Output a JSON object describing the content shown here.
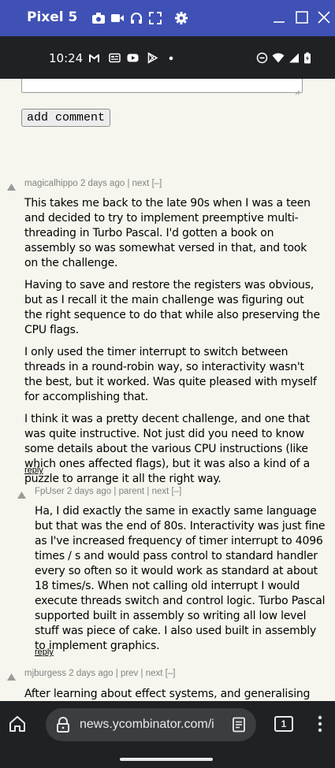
{
  "emulator": {
    "title": "Pixel 5"
  },
  "status": {
    "time": "10:24"
  },
  "form": {
    "add_comment_label": "add comment"
  },
  "comments": [
    {
      "user": "magicalhippo",
      "age": "2 days ago",
      "sep1": "|",
      "link1": "next",
      "toggle": "[–]",
      "paragraphs": [
        "This takes me back to the late 90s when I was a teen and decided to try to implement preemptive multi-threading in Turbo Pascal. I'd gotten a book on assembly so was somewhat versed in that, and took on the challenge.",
        "Having to save and restore the registers was obvious, but as I recall it the main challenge was figuring out the right sequence to do that while also preserving the CPU flags.",
        "I only used the timer interrupt to switch between threads in a round-robin way, so interactivity wasn't the best, but it worked. Was quite pleased with myself for accomplishing that.",
        "I think it was a pretty decent challenge, and one that was quite instructive. Not just did you need to know some details about the various CPU instructions (like which ones affected flags), but it was also a kind of a puzzle to arrange it all the right way."
      ],
      "reply": "reply"
    },
    {
      "user": "FpUser",
      "age": "2 days ago",
      "sep1": "|",
      "link1": "parent",
      "sep2": "|",
      "link2": "next",
      "toggle": "[–]",
      "paragraphs": [
        "Ha, I did exactly the same in exactly same language but that was the end of 80s. Interactivity was just fine as I've increased frequency of timer interrupt to 4096 times / s and would pass control to standard handler every so often so it would work as standard at about 18 times/s. When not calling old interrupt I would execute threads switch and control logic. Turbo Pascal supported built in assembly so writing all low level stuff was piece of cake. I also used built in assembly to implement graphics."
      ],
      "reply": "reply"
    },
    {
      "user": "mjburgess",
      "age": "2 days ago",
      "sep1": "|",
      "link1": "prev",
      "sep2": "|",
      "link2": "next",
      "toggle": "[–]",
      "paragraphs": [
        "After learning about effect systems, and generalising"
      ]
    }
  ],
  "browser": {
    "url": "news.ycombinator.com/i",
    "tab_count": "1"
  },
  "colors": {
    "emulator_bar": "#3f51b5",
    "page_bg": "#f6f6ef",
    "meta_gray": "#828282",
    "system_bar": "#202124"
  }
}
